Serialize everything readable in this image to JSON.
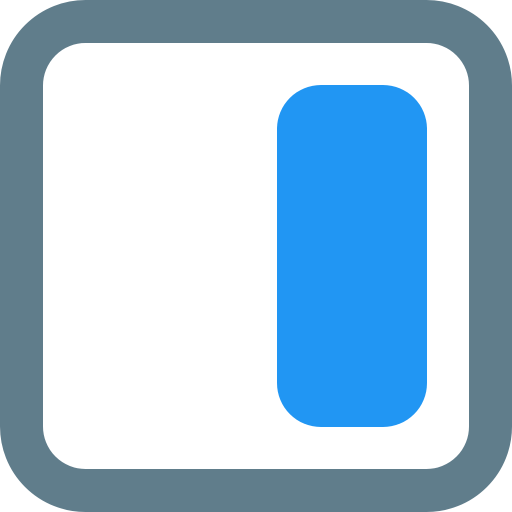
{
  "icon": {
    "name": "sidebar-right-icon",
    "colors": {
      "frame": "#607D8B",
      "panel": "#2196F3",
      "background": "#FFFFFF"
    }
  }
}
